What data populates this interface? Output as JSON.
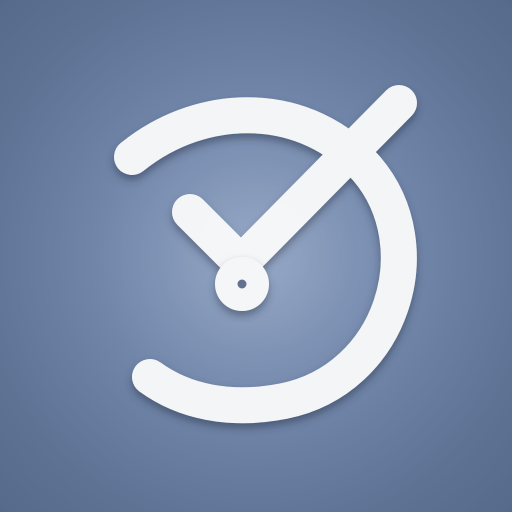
{
  "app_icon": {
    "icon": "clock-check-icon",
    "colors": {
      "background_center": "#8fa2c2",
      "background_edge": "#566a8b",
      "glyph": "#f4f5f7",
      "glyph_shadow": "#3f4e68",
      "pivot_dot": "#5a6888"
    }
  }
}
